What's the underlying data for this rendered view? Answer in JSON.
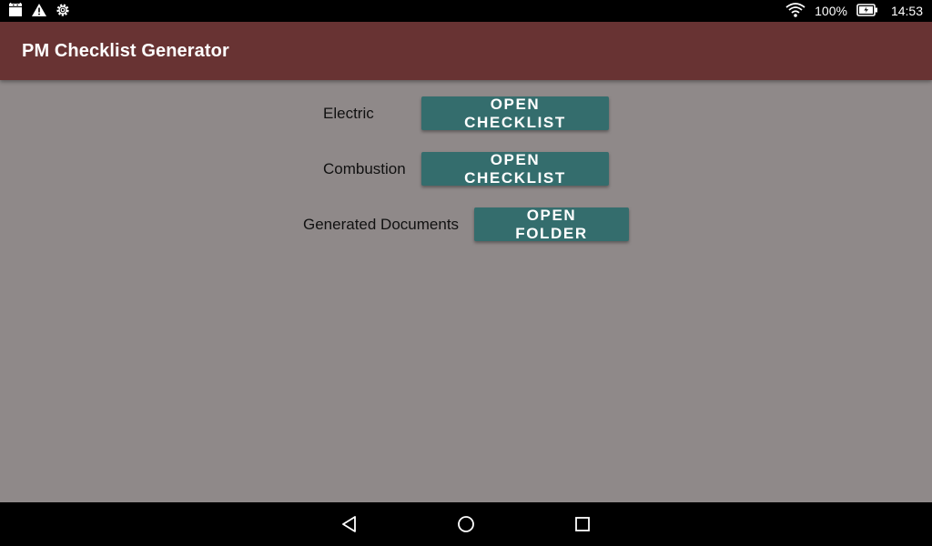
{
  "status_bar": {
    "icons_left": [
      "android-icon",
      "warning-icon",
      "gear-icon"
    ],
    "battery_percent": "100%",
    "time": "14:53",
    "icons_right": [
      "wifi-icon",
      "battery-icon"
    ]
  },
  "app_bar": {
    "title": "PM Checklist Generator",
    "color": "#683333"
  },
  "content": {
    "background": "#8f8989",
    "rows": [
      {
        "label": "Electric",
        "button_label": "OPEN CHECKLIST"
      },
      {
        "label": "Combustion",
        "button_label": "OPEN CHECKLIST"
      },
      {
        "label": "Generated Documents",
        "button_label": "OPEN FOLDER"
      }
    ],
    "button_color": "#346d6d"
  },
  "nav_bar": {
    "buttons": [
      "back-icon",
      "home-icon",
      "recents-icon"
    ]
  }
}
